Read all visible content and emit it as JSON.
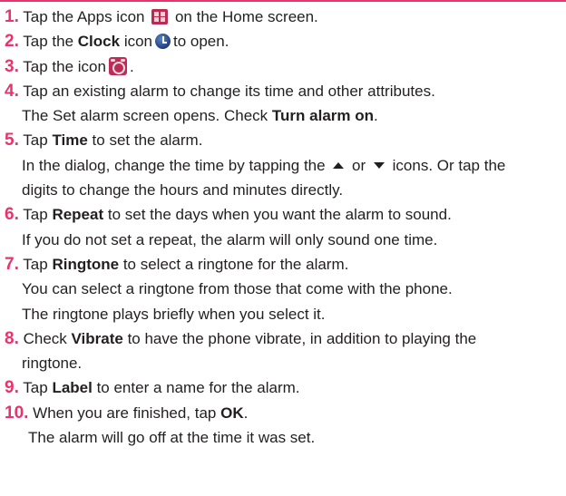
{
  "colors": {
    "accent": "#e8336b",
    "text": "#231f20"
  },
  "icons": {
    "apps": "apps-grid-icon",
    "clock": "clock-icon",
    "alarm": "alarm-clock-icon",
    "up": "up-triangle-icon",
    "down": "down-triangle-icon"
  },
  "steps": {
    "s1": {
      "num": "1.",
      "pre": "Tap the Apps icon",
      "post": "on the Home screen."
    },
    "s2": {
      "num": "2.",
      "pre": "Tap the",
      "bold": "Clock",
      "mid": "icon",
      "post": "to open."
    },
    "s3": {
      "num": "3.",
      "pre": "Tap the icon",
      "post": "."
    },
    "s4": {
      "num": "4.",
      "text": "Tap an existing alarm to change its time and other attributes.",
      "cont_pre": "The Set alarm screen opens. Check",
      "cont_bold": "Turn alarm on",
      "cont_post": "."
    },
    "s5": {
      "num": "5.",
      "pre": "Tap",
      "bold": "Time",
      "post": "to set the alarm.",
      "cont1_pre": "In the dialog, change the time by tapping the",
      "cont1_mid": "or",
      "cont1_post": "icons. Or tap the",
      "cont2": "digits to change the hours and minutes directly."
    },
    "s6": {
      "num": "6.",
      "pre": "Tap",
      "bold": "Repeat",
      "post": "to set the days when you want the alarm to sound.",
      "cont": "If you do not set a repeat, the alarm will only sound one time."
    },
    "s7": {
      "num": "7.",
      "pre": "Tap",
      "bold": "Ringtone",
      "post": "to select a ringtone for the alarm.",
      "cont1": "You can select a ringtone from those that come with the phone.",
      "cont2": "The ringtone plays briefly when you select it."
    },
    "s8": {
      "num": "8.",
      "pre": "Check",
      "bold": "Vibrate",
      "post": "to have the phone vibrate, in addition to playing the",
      "cont": "ringtone."
    },
    "s9": {
      "num": "9.",
      "pre": "Tap",
      "bold": "Label",
      "post": "to enter a name for the alarm."
    },
    "s10": {
      "num": "10.",
      "pre": "When you are finished, tap",
      "bold": "OK",
      "post": ".",
      "cont": "The alarm will go off at the time it was set."
    }
  }
}
